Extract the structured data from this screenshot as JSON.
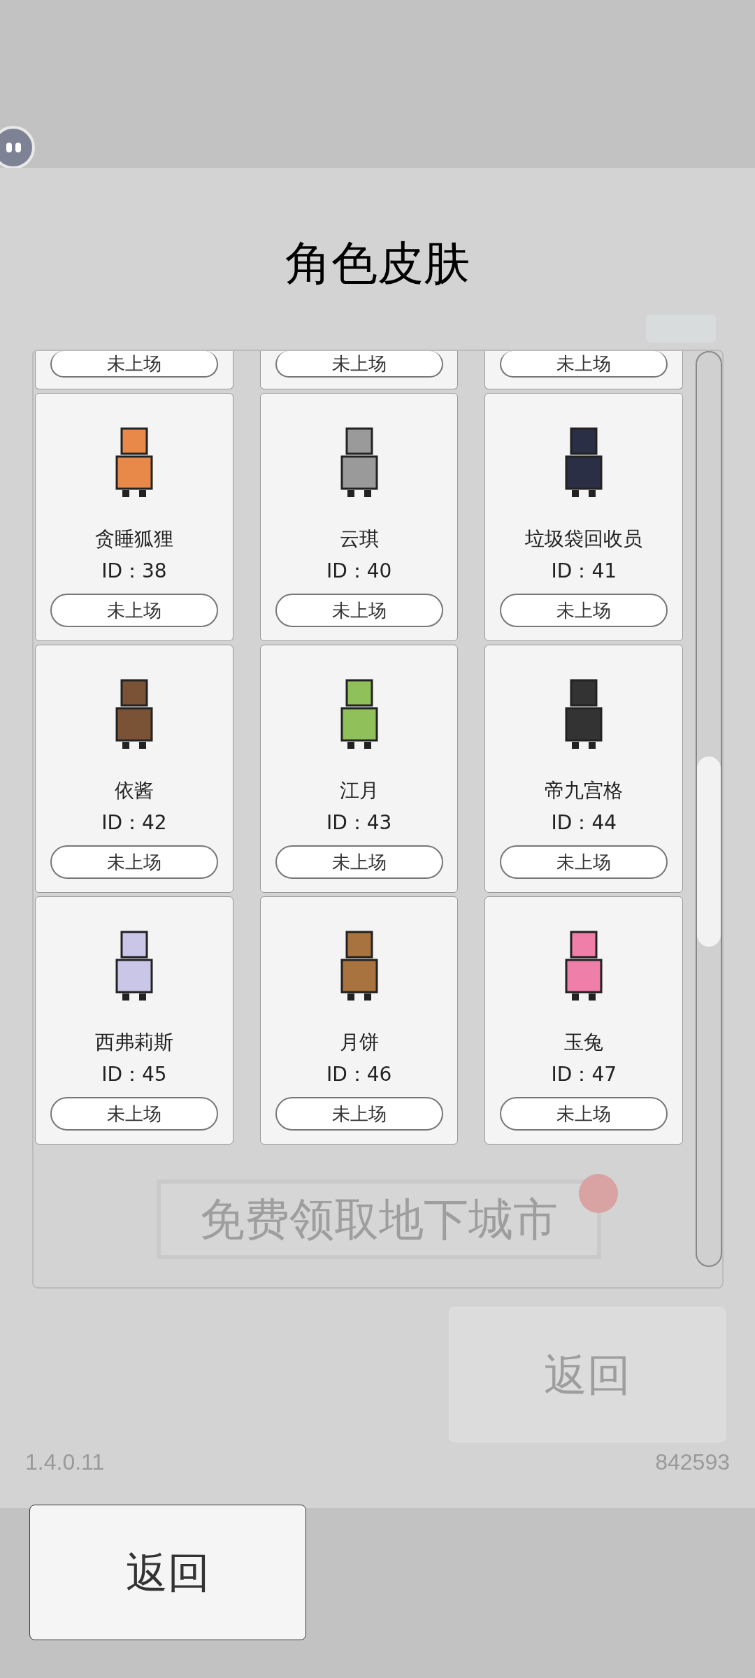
{
  "title": "角色皮肤",
  "partial_row": [
    {
      "button": "未上场"
    },
    {
      "button": "未上场"
    },
    {
      "button": "未上场"
    }
  ],
  "skins": [
    {
      "name": "贪睡狐狸",
      "id": "ID：38",
      "button": "未上场"
    },
    {
      "name": "云琪",
      "id": "ID：40",
      "button": "未上场"
    },
    {
      "name": "垃圾袋回收员",
      "id": "ID：41",
      "button": "未上场"
    },
    {
      "name": "依酱",
      "id": "ID：42",
      "button": "未上场"
    },
    {
      "name": "江月",
      "id": "ID：43",
      "button": "未上场"
    },
    {
      "name": "帝九宫格",
      "id": "ID：44",
      "button": "未上场"
    },
    {
      "name": "西弗莉斯",
      "id": "ID：45",
      "button": "未上场"
    },
    {
      "name": "月饼",
      "id": "ID：46",
      "button": "未上场"
    },
    {
      "name": "玉兔",
      "id": "ID：47",
      "button": "未上场"
    }
  ],
  "background": {
    "reward_button": "免费领取地下城市",
    "back_button": "返回",
    "version": "1.4.0.11",
    "code": "842593"
  },
  "back_button": "返回"
}
